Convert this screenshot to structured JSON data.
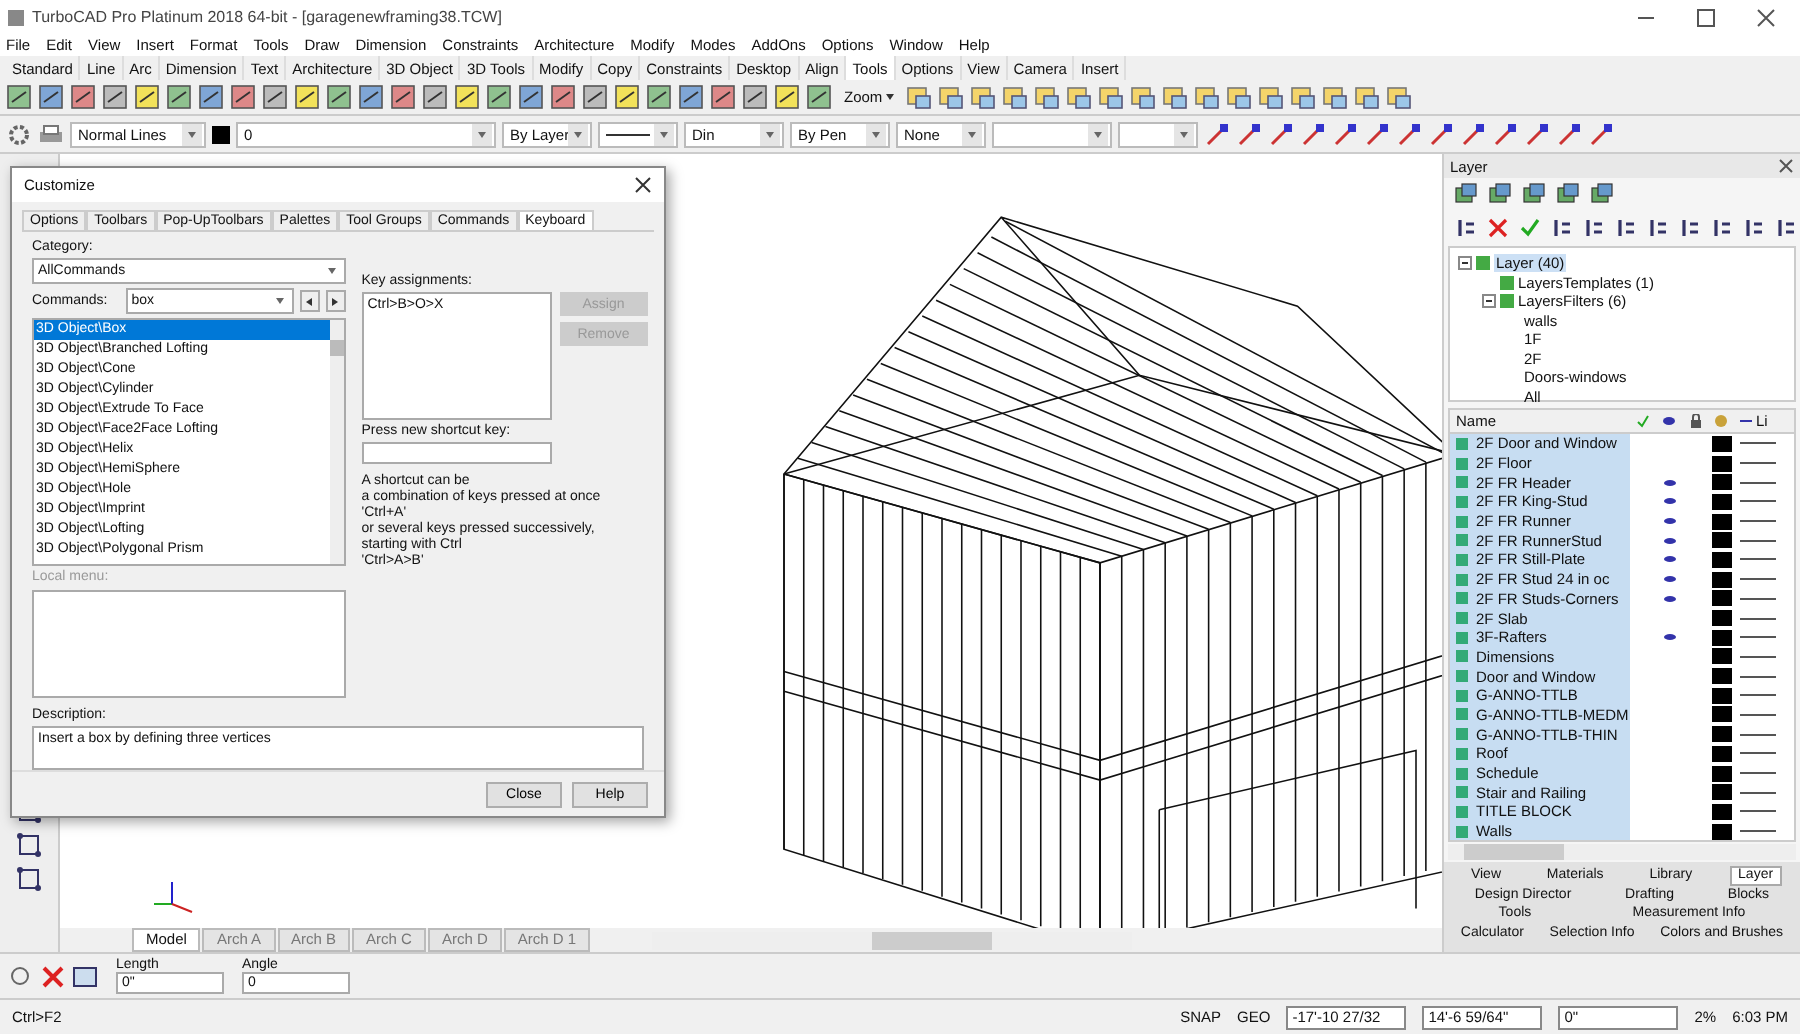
{
  "window": {
    "title": "TurboCAD Pro Platinum 2018 64-bit - [garagenewframing38.TCW]"
  },
  "menu": [
    "File",
    "Edit",
    "View",
    "Insert",
    "Format",
    "Tools",
    "Draw",
    "Dimension",
    "Constraints",
    "Architecture",
    "Modify",
    "Modes",
    "AddOns",
    "Options",
    "Window",
    "Help"
  ],
  "toolbar_tabs": [
    {
      "label": "Standard",
      "selected": false
    },
    {
      "label": "Line",
      "selected": false
    },
    {
      "label": "Arc",
      "selected": false
    },
    {
      "label": "Dimension",
      "selected": false
    },
    {
      "label": "Text",
      "selected": false
    },
    {
      "label": "Architecture",
      "selected": false
    },
    {
      "label": "3D Object",
      "selected": false
    },
    {
      "label": "3D Tools",
      "selected": false
    },
    {
      "label": "Modify",
      "selected": false
    },
    {
      "label": "Copy",
      "selected": false
    },
    {
      "label": "Constraints",
      "selected": false
    },
    {
      "label": "Desktop",
      "selected": false
    },
    {
      "label": "Align",
      "selected": false
    },
    {
      "label": "Tools",
      "selected": true
    },
    {
      "label": "Options",
      "selected": false
    },
    {
      "label": "View",
      "selected": false
    },
    {
      "label": "Camera",
      "selected": false
    },
    {
      "label": "Insert",
      "selected": false
    }
  ],
  "tools_toolbar": {
    "zoom_label": "Zoom"
  },
  "property_bar": {
    "line_style": "Normal Lines",
    "layer_value": "0",
    "color_mode": "By Layer",
    "line_type": "Din",
    "pen_mode": "By Pen",
    "fill": "None"
  },
  "customize_dialog": {
    "title": "Customize",
    "tabs": [
      {
        "label": "Options",
        "selected": false
      },
      {
        "label": "Toolbars",
        "selected": false
      },
      {
        "label": "Pop-UpToolbars",
        "selected": false
      },
      {
        "label": "Palettes",
        "selected": false
      },
      {
        "label": "Tool Groups",
        "selected": false
      },
      {
        "label": "Commands",
        "selected": false
      },
      {
        "label": "Keyboard",
        "selected": true
      }
    ],
    "category_label": "Category:",
    "category": "AllCommands",
    "commands_label": "Commands:",
    "commands_filter": "box",
    "commands": [
      {
        "label": "3D Object\\Box",
        "selected": true
      },
      {
        "label": "3D Object\\Branched Lofting",
        "selected": false
      },
      {
        "label": "3D Object\\Cone",
        "selected": false
      },
      {
        "label": "3D Object\\Cylinder",
        "selected": false
      },
      {
        "label": "3D Object\\Extrude To Face",
        "selected": false
      },
      {
        "label": "3D Object\\Face2Face Lofting",
        "selected": false
      },
      {
        "label": "3D Object\\Helix",
        "selected": false
      },
      {
        "label": "3D Object\\HemiSphere",
        "selected": false
      },
      {
        "label": "3D Object\\Hole",
        "selected": false
      },
      {
        "label": "3D Object\\Imprint",
        "selected": false
      },
      {
        "label": "3D Object\\Lofting",
        "selected": false
      },
      {
        "label": "3D Object\\Polygonal Prism",
        "selected": false
      }
    ],
    "key_assignments_label": "Key assignments:",
    "key_assignments": [
      "Ctrl>B>O>X"
    ],
    "buttons": [
      {
        "label": "Assign",
        "disabled": true
      },
      {
        "label": "Remove",
        "disabled": true
      }
    ],
    "shortcut_label": "Press new shortcut key:",
    "hint_lines": [
      "A shortcut can be",
      "a combination of keys pressed at once",
      "'Ctrl+A'",
      "or several keys pressed successively,",
      "starting with Ctrl",
      "'Ctrl>A>B'"
    ],
    "local_menu_label": "Local menu:",
    "description_label": "Description:",
    "description": "Insert a box by defining three vertices",
    "footer_buttons": [
      "Close",
      "Help"
    ]
  },
  "sheet_tabs": [
    {
      "label": "Model",
      "selected": true
    },
    {
      "label": "Arch A",
      "selected": false
    },
    {
      "label": "Arch B",
      "selected": false
    },
    {
      "label": "Arch C",
      "selected": false
    },
    {
      "label": "Arch D",
      "selected": false
    },
    {
      "label": "Arch D 1",
      "selected": false
    }
  ],
  "layer_panel": {
    "title": "Layer",
    "tree": [
      {
        "label": "Layer (40)",
        "selected": true,
        "children": [
          {
            "label": "LayersTemplates (1)",
            "selected": false
          },
          {
            "label": "LayersFilters (6)",
            "selected": false,
            "children": [
              {
                "label": "walls",
                "selected": false
              },
              {
                "label": "1F",
                "selected": false
              },
              {
                "label": "2F",
                "selected": false
              },
              {
                "label": "Doors-windows",
                "selected": false
              },
              {
                "label": "All",
                "selected": false
              }
            ]
          }
        ]
      }
    ],
    "columns": [
      "Name",
      "Li"
    ],
    "rows": [
      {
        "name": "2F Door and Window",
        "eye": false
      },
      {
        "name": "2F Floor",
        "eye": false
      },
      {
        "name": "2F FR Header",
        "eye": true
      },
      {
        "name": "2F FR King-Stud",
        "eye": true
      },
      {
        "name": "2F FR Runner",
        "eye": true
      },
      {
        "name": "2F FR RunnerStud",
        "eye": true
      },
      {
        "name": "2F FR Still-Plate",
        "eye": true
      },
      {
        "name": "2F FR Stud 24 in oc",
        "eye": true
      },
      {
        "name": "2F FR Studs-Corners",
        "eye": true
      },
      {
        "name": "2F Slab",
        "eye": false
      },
      {
        "name": "3F-Rafters",
        "eye": true
      },
      {
        "name": "Dimensions",
        "eye": false
      },
      {
        "name": "Door and Window",
        "eye": false
      },
      {
        "name": "G-ANNO-TTLB",
        "eye": false
      },
      {
        "name": "G-ANNO-TTLB-MEDM",
        "eye": false
      },
      {
        "name": "G-ANNO-TTLB-THIN",
        "eye": false
      },
      {
        "name": "Roof",
        "eye": false
      },
      {
        "name": "Schedule",
        "eye": false
      },
      {
        "name": "Stair and Railing",
        "eye": false
      },
      {
        "name": "TITLE BLOCK",
        "eye": false
      },
      {
        "name": "Walls",
        "eye": false
      }
    ],
    "palette_tabs": [
      [
        {
          "label": "View",
          "selected": false
        },
        {
          "label": "Materials",
          "selected": false
        },
        {
          "label": "Library",
          "selected": false
        },
        {
          "label": "Layer",
          "selected": true
        }
      ],
      [
        {
          "label": "Design Director",
          "selected": false
        },
        {
          "label": "Drafting",
          "selected": false
        },
        {
          "label": "Blocks",
          "selected": false
        }
      ],
      [
        {
          "label": "Tools",
          "selected": false
        },
        {
          "label": "Measurement Info",
          "selected": false
        }
      ],
      [
        {
          "label": "Calculator",
          "selected": false
        },
        {
          "label": "Selection Info",
          "selected": false
        },
        {
          "label": "Colors and Brushes",
          "selected": false
        }
      ]
    ]
  },
  "input_bar": {
    "fields": [
      {
        "label": "Length",
        "value": "0\""
      },
      {
        "label": "Angle",
        "value": "0"
      }
    ]
  },
  "status_bar": {
    "prompt": "Ctrl>F2",
    "flags": [
      "SNAP",
      "GEO"
    ],
    "coords": [
      "-17'-10 27/32",
      "14'-6 59/64\"",
      "0\""
    ],
    "zoom": "2%",
    "time": "6:03 PM"
  }
}
